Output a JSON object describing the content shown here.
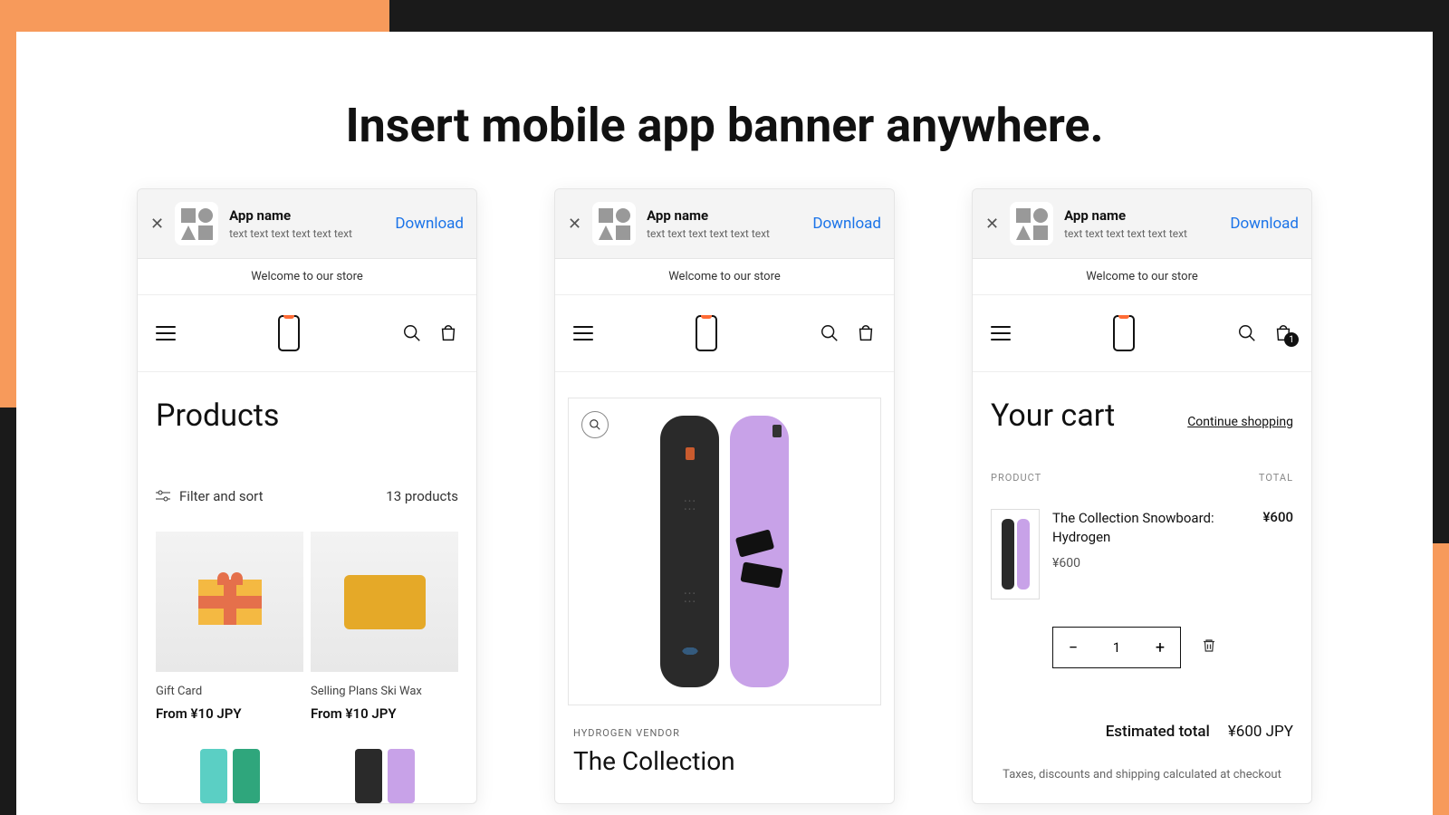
{
  "headline": "Insert mobile app banner anywhere.",
  "banner": {
    "app_name": "App name",
    "subtitle": "text text text text text text",
    "download": "Download"
  },
  "welcome": "Welcome to our store",
  "screen1": {
    "title": "Products",
    "filter": "Filter and sort",
    "count": "13 products",
    "products": [
      {
        "name": "Gift Card",
        "price": "From ¥10 JPY"
      },
      {
        "name": "Selling Plans Ski Wax",
        "price": "From ¥10 JPY"
      }
    ]
  },
  "screen2": {
    "vendor": "HYDROGEN VENDOR",
    "title": "The Collection"
  },
  "screen3": {
    "title": "Your cart",
    "continue": "Continue shopping",
    "col_product": "PRODUCT",
    "col_total": "TOTAL",
    "item": {
      "name": "The Collection Snowboard: Hydrogen",
      "price": "¥600",
      "line_total": "¥600",
      "qty": "1"
    },
    "badge": "1",
    "est_label": "Estimated total",
    "est_value": "¥600 JPY",
    "tax_note": "Taxes, discounts and shipping calculated at checkout"
  }
}
